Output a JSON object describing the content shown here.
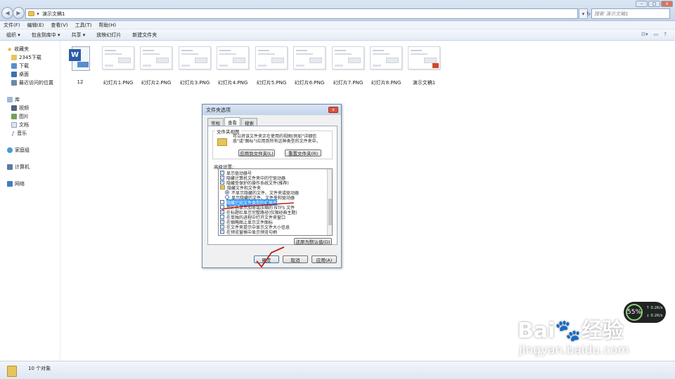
{
  "address": {
    "path": "演示文稿1",
    "search_placeholder": "搜索 演示文稿1"
  },
  "menu": [
    "文件(F)",
    "编辑(E)",
    "查看(V)",
    "工具(T)",
    "帮助(H)"
  ],
  "toolbar": [
    "组织 ▾",
    "包含到库中 ▾",
    "共享 ▾",
    "放映幻灯片",
    "新建文件夹"
  ],
  "sidebar": {
    "favorites": "收藏夹",
    "fav_items": [
      "2345下载",
      "下载",
      "桌面",
      "最近访问的位置"
    ],
    "library": "库",
    "lib_items": [
      "视频",
      "图片",
      "文档",
      "音乐"
    ],
    "homegroup": "家庭组",
    "computer": "计算机",
    "network": "网络"
  },
  "files": [
    "12",
    "幻灯片1.PNG",
    "幻灯片2.PNG",
    "幻灯片3.PNG",
    "幻灯片4.PNG",
    "幻灯片5.PNG",
    "幻灯片6.PNG",
    "幻灯片7.PNG",
    "幻灯片8.PNG",
    "演示文稿1"
  ],
  "status": {
    "count": "10 个对象"
  },
  "dialog": {
    "title": "文件夹选项",
    "tabs": [
      "常规",
      "查看",
      "搜索"
    ],
    "group_label": "文件夹视图",
    "group_text": "可以将该文件夹正在使用的视图(例如\"详细信息\"或\"图标\")应用到所有这种类型的文件夹中。",
    "apply_folders": "应用到文件夹(L)",
    "reset_folders": "重置文件夹(R)",
    "advanced_label": "高级设置:",
    "rows": [
      "显示驱动器号",
      "隐藏计算机文件夹中的空驱动器",
      "隐藏受保护的操作系统文件(推荐)",
      "隐藏文件和文件夹",
      "不显示隐藏的文件、文件夹或驱动器",
      "显示隐藏的文件、文件夹和驱动器",
      "隐藏已知文件类型的扩展名",
      "用彩色显示加密或压缩的 NTFS 文件",
      "在标题栏显示完整路径(仅限经典主题)",
      "在单独的进程中打开文件夹窗口",
      "在缩略图上显示文件图标",
      "在文件夹提示中显示文件大小信息",
      "在预览窗格中显示预览句柄"
    ],
    "restore": "还原为默认值(D)",
    "ok": "确定",
    "cancel": "取消",
    "apply": "应用(A)"
  },
  "widget": {
    "percent": "55%",
    "up": "0.2K/s",
    "down": "0.2K/s"
  },
  "watermark": {
    "brand": "Bai",
    "brand2": "经验",
    "url": "jingyan.baidu.com"
  }
}
